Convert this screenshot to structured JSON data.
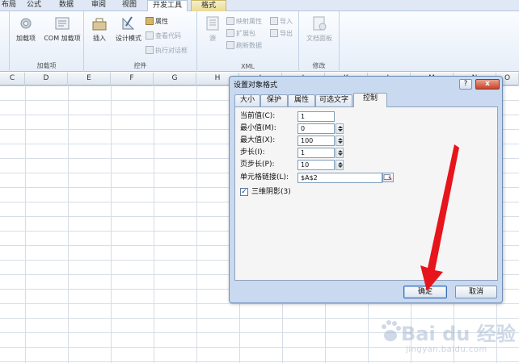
{
  "ribbon": {
    "tabs": [
      {
        "label": "布局"
      },
      {
        "label": "公式"
      },
      {
        "label": "数据"
      },
      {
        "label": "审阅"
      },
      {
        "label": "视图"
      },
      {
        "label": "开发工具",
        "active": true
      },
      {
        "label": "格式"
      }
    ],
    "groups": {
      "addins": {
        "label": "加载项",
        "buttons": [
          "加载项",
          "COM 加载项"
        ]
      },
      "controls": {
        "label": "控件",
        "buttons": [
          "插入",
          "设计模式"
        ],
        "small_buttons": [
          "属性",
          "查看代码",
          "执行对话框"
        ]
      },
      "xml": {
        "label": "XML",
        "source": "源",
        "small_buttons": [
          "映射属性",
          "扩展包",
          "刷新数据",
          "导入",
          "导出"
        ]
      },
      "modify": {
        "label": "修改",
        "buttons": [
          "文档面板"
        ]
      }
    }
  },
  "columns": [
    "C",
    "D",
    "E",
    "F",
    "G",
    "H",
    "I",
    "J",
    "K",
    "L",
    "M",
    "N",
    "O"
  ],
  "dialog": {
    "title": "设置对象格式",
    "help": "?",
    "close": "x",
    "tabs": [
      "大小",
      "保护",
      "属性",
      "可选文字",
      "控制"
    ],
    "active_tab": "控制",
    "fields": {
      "current": {
        "label": "当前值(C):",
        "value": "1"
      },
      "min": {
        "label": "最小值(M):",
        "value": "0"
      },
      "max": {
        "label": "最大值(X):",
        "value": "100"
      },
      "step": {
        "label": "步长(I):",
        "value": "1"
      },
      "page": {
        "label": "页步长(P):",
        "value": "10"
      },
      "link": {
        "label": "单元格链接(L):",
        "value": "$A$2"
      }
    },
    "shading": {
      "label": "三维阴影(3)",
      "checked": true,
      "mark": "✓"
    },
    "ok": "确定",
    "cancel": "取消"
  },
  "watermark": {
    "text": "Bai du 经验",
    "sub": "jingyan.baidu.com"
  },
  "colors": {
    "arrow": "#e8141c",
    "ribbon_bg": "#e6eef9",
    "dialog_bg": "#c9d9ef"
  }
}
